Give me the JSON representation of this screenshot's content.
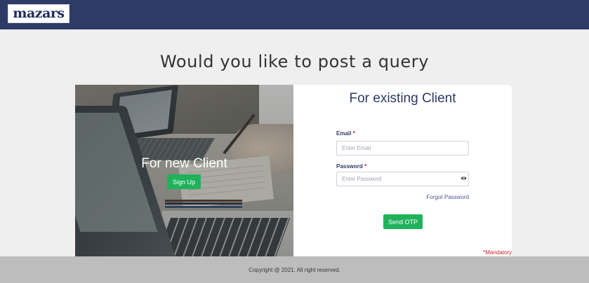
{
  "header": {
    "logo_text": "mazars"
  },
  "page": {
    "heading": "Would you like to post a query"
  },
  "new_client": {
    "title": "For new Client",
    "signup_label": "Sign Up"
  },
  "existing_client": {
    "title": "For existing Client",
    "email_label": "Email",
    "email_placeholder": "Enter Email",
    "email_value": "",
    "password_label": "Password",
    "password_placeholder": "Enter Password",
    "password_value": "",
    "required_marker": "*",
    "forgot_password_label": "Forgot Password",
    "send_otp_label": "Send OTP",
    "mandatory_note": "*Mandatory"
  },
  "footer": {
    "copyright": "Copyright @ 2021. All right reserved."
  },
  "colors": {
    "header_bg": "#2e3a67",
    "button_green": "#1fb25a",
    "required_red": "#d0202a",
    "footer_bg": "#bdbdbd"
  }
}
